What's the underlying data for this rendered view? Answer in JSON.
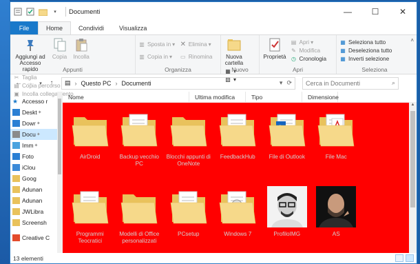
{
  "window": {
    "title": "Documenti"
  },
  "ribbon_tabs": [
    "File",
    "Home",
    "Condividi",
    "Visualizza"
  ],
  "ribbon": {
    "appunti": {
      "label": "Appunti",
      "pin": "Aggiungi ad\nAccesso rapido",
      "copy": "Copia",
      "paste": "Incolla",
      "cut": "Taglia",
      "copy_path": "Copia percorso",
      "paste_link": "Incolla collegamento"
    },
    "organizza": {
      "label": "Organizza",
      "move": "Sposta in",
      "copy_to": "Copia in",
      "delete": "Elimina",
      "rename": "Rinomina"
    },
    "nuovo": {
      "label": "Nuovo",
      "new_folder": "Nuova\ncartella"
    },
    "apri": {
      "label": "Apri",
      "properties": "Proprietà",
      "open": "Apri",
      "edit": "Modifica",
      "history": "Cronologia"
    },
    "seleziona": {
      "label": "Seleziona",
      "select_all": "Seleziona tutto",
      "deselect_all": "Deseleziona tutto",
      "invert": "Inverti selezione"
    }
  },
  "address": {
    "segments": [
      "Questo PC",
      "Documenti"
    ]
  },
  "search": {
    "placeholder": "Cerca in Documenti"
  },
  "nav_items": [
    {
      "label": "Accesso r",
      "icon": "star-icon"
    },
    {
      "label": "Deskt",
      "icon": "desktop-icon"
    },
    {
      "label": "Dowr",
      "icon": "download-icon"
    },
    {
      "label": "Docu",
      "icon": "documents-icon"
    },
    {
      "label": "Imm",
      "icon": "pictures-icon"
    },
    {
      "label": "Foto",
      "icon": "photos-icon"
    },
    {
      "label": "iClou",
      "icon": "icloud-icon"
    },
    {
      "label": "Goog",
      "icon": "folder-icon"
    },
    {
      "label": "Adunan",
      "icon": "folder-icon"
    },
    {
      "label": "Adunan",
      "icon": "folder-icon"
    },
    {
      "label": "JWLibra",
      "icon": "folder-icon"
    },
    {
      "label": "Screensh",
      "icon": "folder-icon"
    },
    {
      "label": "Creative C",
      "icon": "creative-cloud-icon"
    }
  ],
  "columns": [
    "Nome",
    "Ultima modifica",
    "Tipo",
    "Dimensione"
  ],
  "items": [
    {
      "name": "AirDroid",
      "kind": "folder"
    },
    {
      "name": "Backup vecchio PC",
      "kind": "folder-doc"
    },
    {
      "name": "Blocchi appunti di OneNote",
      "kind": "folder-plain"
    },
    {
      "name": "FeedbackHub",
      "kind": "folder-docs"
    },
    {
      "name": "File di Outlook",
      "kind": "folder-outlook"
    },
    {
      "name": "File Mac",
      "kind": "folder-pdf"
    },
    {
      "name": "",
      "kind": "none"
    },
    {
      "name": "Programmi Teocratici",
      "kind": "folder-doc"
    },
    {
      "name": "Modelli di Office personalizzati",
      "kind": "folder-plain"
    },
    {
      "name": "PCsetup",
      "kind": "folder-doc"
    },
    {
      "name": "Windows 7",
      "kind": "folder-disc"
    },
    {
      "name": "ProfiloIMG",
      "kind": "photo-light"
    },
    {
      "name": "AS",
      "kind": "photo-dark"
    }
  ],
  "status": {
    "count": "13 elementi"
  },
  "colors": {
    "content_bg": "#ff0000",
    "accent": "#1979ca",
    "folder": "#f6d98a"
  }
}
